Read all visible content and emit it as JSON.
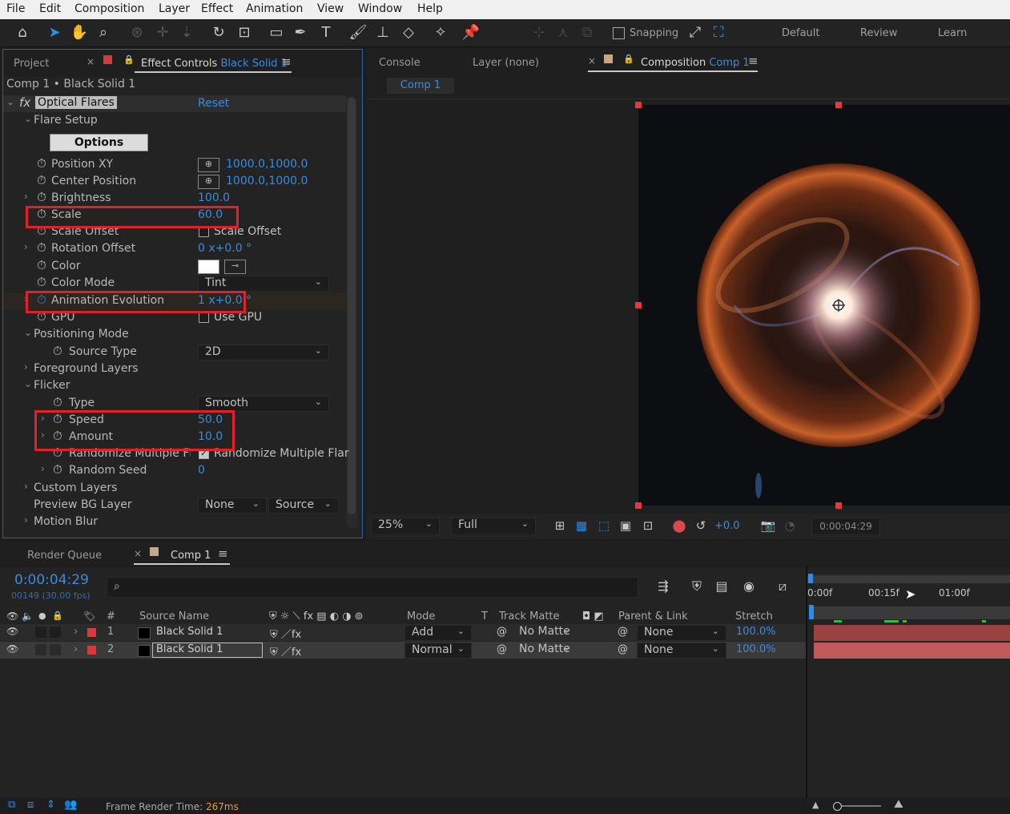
{
  "menu": [
    "File",
    "Edit",
    "Composition",
    "Layer",
    "Effect",
    "Animation",
    "View",
    "Window",
    "Help"
  ],
  "toolbar": {
    "snapping_label": "Snapping",
    "workspaces": [
      "Default",
      "Review",
      "Learn"
    ]
  },
  "left_panel": {
    "tabs": {
      "project": "Project",
      "effect_controls": "Effect Controls",
      "effect_controls_layer": "Black Solid 1"
    },
    "breadcrumb": "Comp 1 • Black Solid 1",
    "effect_name": "Optical Flares",
    "reset_label": "Reset",
    "flare_setup": "Flare Setup",
    "options_button": "Options",
    "properties": {
      "position_xy": {
        "label": "Position XY",
        "value": "1000.0,1000.0"
      },
      "center_position": {
        "label": "Center Position",
        "value": "1000.0,1000.0"
      },
      "brightness": {
        "label": "Brightness",
        "value": "100.0"
      },
      "scale": {
        "label": "Scale",
        "value": "60.0"
      },
      "scale_offset": {
        "label": "Scale Offset",
        "check_label": "Scale Offset"
      },
      "rotation_offset": {
        "label": "Rotation Offset",
        "value": "0 x+0.0 °"
      },
      "color": {
        "label": "Color",
        "swatch": "#ffffff"
      },
      "color_mode": {
        "label": "Color Mode",
        "value": "Tint"
      },
      "animation_evolution": {
        "label": "Animation Evolution",
        "value": "1 x+0.0 °"
      },
      "gpu": {
        "label": "GPU",
        "check_label": "Use GPU"
      },
      "positioning_mode": "Positioning Mode",
      "source_type": {
        "label": "Source Type",
        "value": "2D"
      },
      "foreground_layers": "Foreground Layers",
      "flicker": "Flicker",
      "type": {
        "label": "Type",
        "value": "Smooth"
      },
      "speed": {
        "label": "Speed",
        "value": "50.0"
      },
      "amount": {
        "label": "Amount",
        "value": "10.0"
      },
      "randomize": {
        "label": "Randomize Multiple Flar",
        "check_label": "Randomize Multiple Flar"
      },
      "random_seed": {
        "label": "Random Seed",
        "value": "0"
      },
      "custom_layers": "Custom Layers",
      "preview_bg": {
        "label": "Preview BG Layer",
        "value1": "None",
        "value2": "Source"
      },
      "motion_blur": "Motion Blur"
    }
  },
  "comp_panel": {
    "tabs": {
      "console": "Console",
      "layer": "Layer (none)",
      "composition": "Composition",
      "composition_name": "Comp 1"
    },
    "subtab": "Comp 1",
    "footer": {
      "zoom": "25%",
      "resolution": "Full",
      "exposure": "+0.0",
      "timecode": "0:00:04:29"
    }
  },
  "timeline": {
    "tabs": {
      "render_queue": "Render Queue",
      "comp": "Comp 1"
    },
    "timecode": "0:00:04:29",
    "frame_info": "00149 (30.00 fps)",
    "ruler": [
      "0:00f",
      "00:15f",
      "01:00f"
    ],
    "columns": {
      "num": "#",
      "source_name": "Source Name",
      "mode": "Mode",
      "t": "T",
      "track_matte": "Track Matte",
      "parent": "Parent & Link",
      "stretch": "Stretch"
    },
    "layers": [
      {
        "num": "1",
        "name": "Black Solid 1",
        "mode": "Add",
        "matte": "No Matte",
        "parent": "None",
        "stretch": "100.0%"
      },
      {
        "num": "2",
        "name": "Black Solid 1",
        "mode": "Normal",
        "matte": "No Matte",
        "parent": "None",
        "stretch": "100.0%"
      }
    ],
    "status_label": "Frame Render Time:",
    "status_value": "267ms"
  }
}
